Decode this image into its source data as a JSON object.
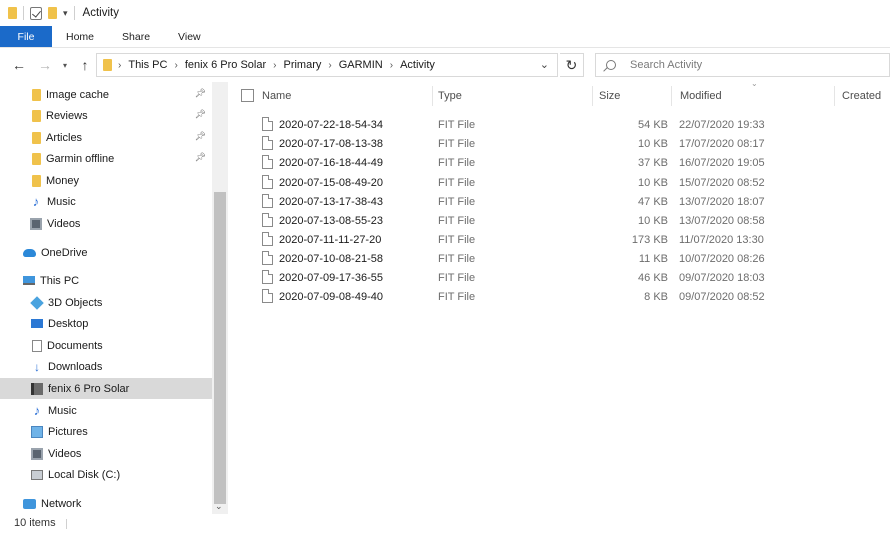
{
  "window": {
    "title": "Activity"
  },
  "ribbon": {
    "tabs": [
      "File",
      "Home",
      "Share",
      "View"
    ]
  },
  "address": {
    "crumbs": [
      "This PC",
      "fenix 6 Pro Solar",
      "Primary",
      "GARMIN",
      "Activity"
    ]
  },
  "search": {
    "placeholder": "Search Activity"
  },
  "sidebar": {
    "items": [
      {
        "label": "Image cache",
        "icon": "folder-icon",
        "pinned": true
      },
      {
        "label": "Reviews",
        "icon": "folder-icon",
        "pinned": true
      },
      {
        "label": "Articles",
        "icon": "folder-icon",
        "pinned": true
      },
      {
        "label": "Garmin offline",
        "icon": "folder-icon",
        "pinned": true
      },
      {
        "label": "Money",
        "icon": "folder-icon",
        "pinned": false
      },
      {
        "label": "Music",
        "icon": "music-icon",
        "pinned": false
      },
      {
        "label": "Videos",
        "icon": "videos-icon",
        "pinned": false
      },
      {
        "label": "OneDrive",
        "icon": "onedrive-icon",
        "pinned": false
      },
      {
        "label": "This PC",
        "icon": "this-pc-icon",
        "pinned": false
      },
      {
        "label": "3D Objects",
        "icon": "3d-objects-icon",
        "pinned": false
      },
      {
        "label": "Desktop",
        "icon": "desktop-icon",
        "pinned": false
      },
      {
        "label": "Documents",
        "icon": "documents-icon",
        "pinned": false
      },
      {
        "label": "Downloads",
        "icon": "downloads-icon",
        "pinned": false
      },
      {
        "label": "fenix 6 Pro Solar",
        "icon": "device-icon",
        "pinned": false,
        "selected": true
      },
      {
        "label": "Music",
        "icon": "music-icon",
        "pinned": false
      },
      {
        "label": "Pictures",
        "icon": "pictures-icon",
        "pinned": false
      },
      {
        "label": "Videos",
        "icon": "videos-icon",
        "pinned": false
      },
      {
        "label": "Local Disk (C:)",
        "icon": "local-disk-icon",
        "pinned": false
      },
      {
        "label": "Network",
        "icon": "network-icon",
        "pinned": false
      }
    ]
  },
  "columns": {
    "name": "Name",
    "type": "Type",
    "size": "Size",
    "modified": "Modified",
    "created": "Created"
  },
  "files": [
    {
      "name": "2020-07-22-18-54-34",
      "type": "FIT File",
      "size": "54 KB",
      "modified": "22/07/2020 19:33"
    },
    {
      "name": "2020-07-17-08-13-38",
      "type": "FIT File",
      "size": "10 KB",
      "modified": "17/07/2020 08:17"
    },
    {
      "name": "2020-07-16-18-44-49",
      "type": "FIT File",
      "size": "37 KB",
      "modified": "16/07/2020 19:05"
    },
    {
      "name": "2020-07-15-08-49-20",
      "type": "FIT File",
      "size": "10 KB",
      "modified": "15/07/2020 08:52"
    },
    {
      "name": "2020-07-13-17-38-43",
      "type": "FIT File",
      "size": "47 KB",
      "modified": "13/07/2020 18:07"
    },
    {
      "name": "2020-07-13-08-55-23",
      "type": "FIT File",
      "size": "10 KB",
      "modified": "13/07/2020 08:58"
    },
    {
      "name": "2020-07-11-11-27-20",
      "type": "FIT File",
      "size": "173 KB",
      "modified": "11/07/2020 13:30"
    },
    {
      "name": "2020-07-10-08-21-58",
      "type": "FIT File",
      "size": "11 KB",
      "modified": "10/07/2020 08:26"
    },
    {
      "name": "2020-07-09-17-36-55",
      "type": "FIT File",
      "size": "46 KB",
      "modified": "09/07/2020 18:03"
    },
    {
      "name": "2020-07-09-08-49-40",
      "type": "FIT File",
      "size": "8 KB",
      "modified": "09/07/2020 08:52"
    }
  ],
  "status": {
    "count": "10 items"
  },
  "colors": {
    "accent": "#1b6ac9",
    "folder": "#f0c24b",
    "selected": "#d9d9d9"
  }
}
